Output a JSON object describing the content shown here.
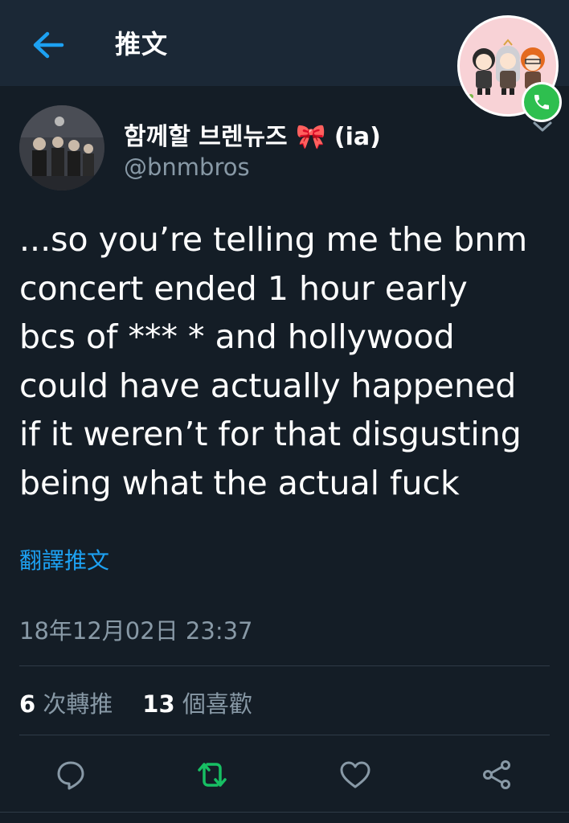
{
  "header": {
    "title": "推文"
  },
  "tweet": {
    "display_name": "함께할 브렌뉴즈 🎀 (ia)",
    "handle": "@bnmbros",
    "text": "...so you’re telling me the bnm\nconcert ended 1 hour early\nbcs of *** * and hollywood\ncould have actually happened\nif it weren’t for that disgusting\nbeing what the actual fuck",
    "translate_label": "翻譯推文",
    "timestamp": "18年12月02日 23:37",
    "retweet_count": "6",
    "retweet_label": "次轉推",
    "like_count": "13",
    "like_label": "個喜歡"
  },
  "colors": {
    "background": "#141d26",
    "topbar": "#1b2836",
    "accent": "#1da1f2",
    "retweet_green": "#17bf63",
    "muted": "#8899a6",
    "call_green": "#2ebf4f"
  },
  "icons": {
    "back": "arrow-left-icon",
    "caret": "chevron-down-icon",
    "reply": "reply-icon",
    "retweet": "retweet-icon",
    "like": "heart-icon",
    "share": "share-icon",
    "call": "phone-icon"
  }
}
